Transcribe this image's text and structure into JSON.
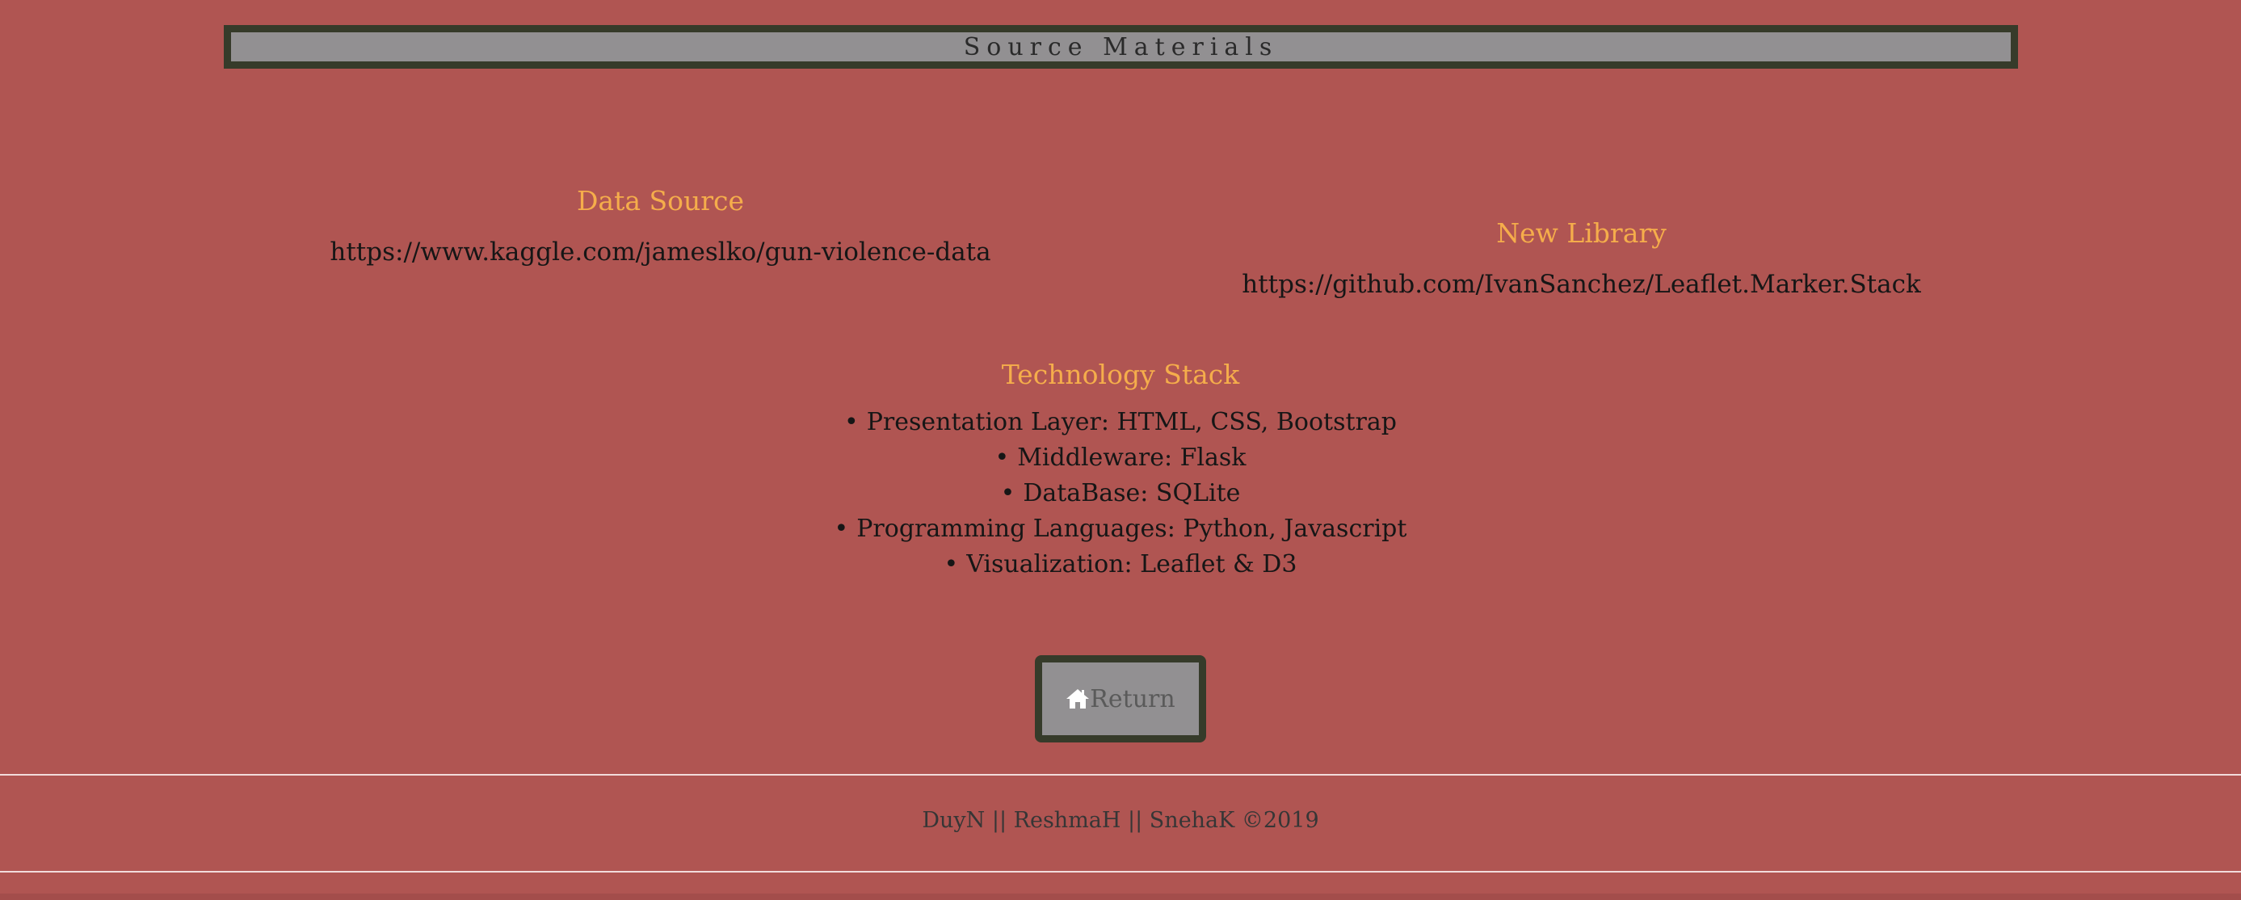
{
  "header": {
    "title": "Source Materials"
  },
  "data_source": {
    "heading": "Data Source",
    "link": "https://www.kaggle.com/jameslko/gun-violence-data"
  },
  "new_library": {
    "heading": "New Library",
    "link": "https://github.com/IvanSanchez/Leaflet.Marker.Stack"
  },
  "tech_stack": {
    "heading": "Technology Stack",
    "bullet": "•",
    "items": [
      "Presentation Layer: HTML, CSS, Bootstrap",
      "Middleware: Flask",
      "DataBase: SQLite",
      "Programming Languages: Python, Javascript",
      "Visualization: Leaflet & D3"
    ]
  },
  "return_button": {
    "label": "Return",
    "icon": "home-icon"
  },
  "footer": {
    "text": "DuyN || ReshmaH || SnehaK ©2019"
  },
  "colors": {
    "background": "#b05552",
    "accent": "#f5ad4b",
    "panel": "#929092",
    "border": "#363b2a"
  }
}
